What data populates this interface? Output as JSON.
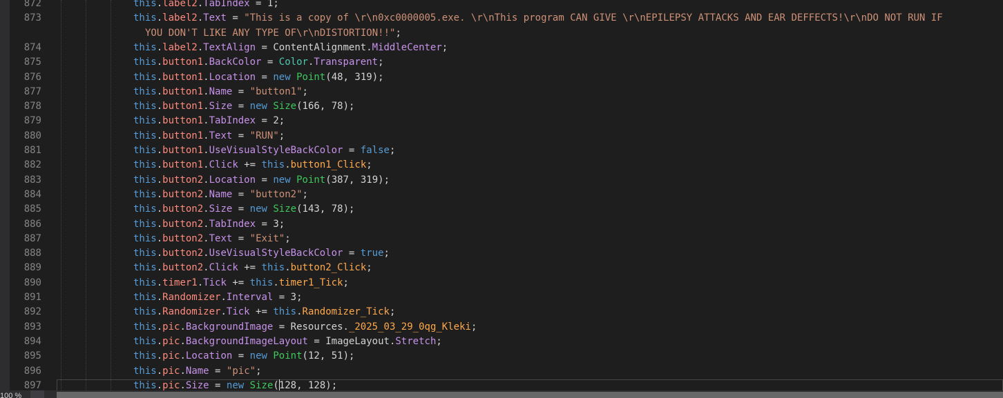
{
  "editor": {
    "lines": [
      {
        "num": "872",
        "code": "this.label2.TabIndex = 1;"
      },
      {
        "num": "873",
        "code": "this.label2.Text = \"This is a copy of \\r\\n0xc0000005.exe. \\r\\nThis program CAN GIVE \\r\\nEPILEPSY ATTACKS AND EAR DEFFECTS!\\r\\nDO NOT RUN IF",
        "cont": "YOU DON'T LIKE ANY TYPE OF\\r\\nDISTORTION!!\";"
      },
      {
        "num": "874",
        "code": "this.label2.TextAlign = ContentAlignment.MiddleCenter;"
      },
      {
        "num": "875",
        "code": "this.button1.BackColor = Color.Transparent;"
      },
      {
        "num": "876",
        "code": "this.button1.Location = new Point(48, 319);"
      },
      {
        "num": "877",
        "code": "this.button1.Name = \"button1\";"
      },
      {
        "num": "878",
        "code": "this.button1.Size = new Size(166, 78);"
      },
      {
        "num": "879",
        "code": "this.button1.TabIndex = 2;"
      },
      {
        "num": "880",
        "code": "this.button1.Text = \"RUN\";"
      },
      {
        "num": "881",
        "code": "this.button1.UseVisualStyleBackColor = false;"
      },
      {
        "num": "882",
        "code": "this.button1.Click += this.button1_Click;"
      },
      {
        "num": "883",
        "code": "this.button2.Location = new Point(387, 319);"
      },
      {
        "num": "884",
        "code": "this.button2.Name = \"button2\";"
      },
      {
        "num": "885",
        "code": "this.button2.Size = new Size(143, 78);"
      },
      {
        "num": "886",
        "code": "this.button2.TabIndex = 3;"
      },
      {
        "num": "887",
        "code": "this.button2.Text = \"Exit\";"
      },
      {
        "num": "888",
        "code": "this.button2.UseVisualStyleBackColor = true;"
      },
      {
        "num": "889",
        "code": "this.button2.Click += this.button2_Click;"
      },
      {
        "num": "890",
        "code": "this.timer1.Tick += this.timer1_Tick;"
      },
      {
        "num": "891",
        "code": "this.Randomizer.Interval = 3;"
      },
      {
        "num": "892",
        "code": "this.Randomizer.Tick += this.Randomizer_Tick;"
      },
      {
        "num": "893",
        "code": "this.pic.BackgroundImage = Resources._2025_03_29_0qg_Kleki;"
      },
      {
        "num": "894",
        "code": "this.pic.BackgroundImageLayout = ImageLayout.Stretch;"
      },
      {
        "num": "895",
        "code": "this.pic.Location = new Point(12, 51);"
      },
      {
        "num": "896",
        "code": "this.pic.Name = \"pic\";"
      },
      {
        "num": "897",
        "code": "this.pic.Size = new Size(128, 128);"
      }
    ],
    "current_line": "897",
    "caret_after": "this.pic.Size = new Size("
  },
  "status_bar": {
    "zoom": "100 %"
  },
  "colors": {
    "background": "#1e1e1e",
    "line_number": "#858585",
    "keyword": "#569cd6",
    "property": "#c792ea",
    "member": "#ff8b7e",
    "string": "#ce9178",
    "number": "#b5cea8",
    "type": "#4ec9b0",
    "method": "#ffa94d"
  }
}
